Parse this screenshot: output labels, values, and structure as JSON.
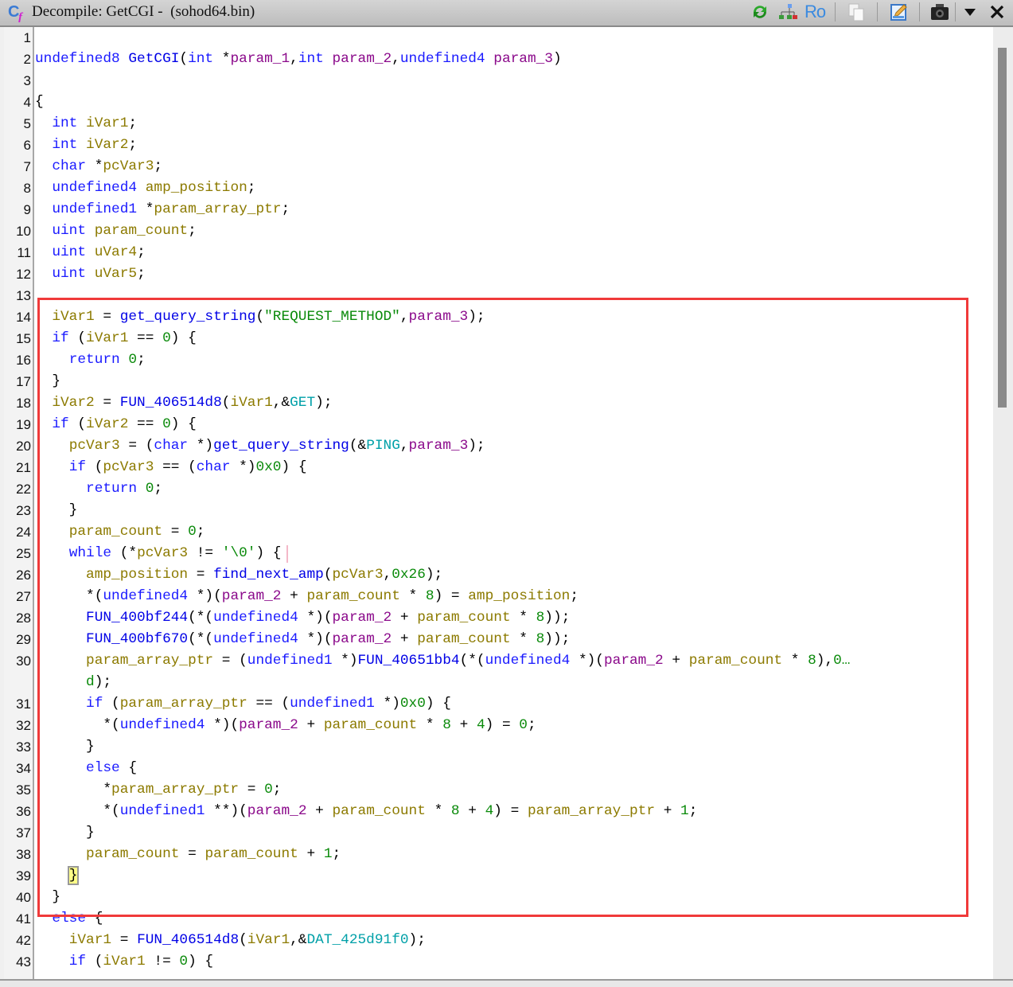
{
  "window": {
    "title": "Decompile: GetCGI -  (sohod64.bin)",
    "icon": "decompiler-cf-icon",
    "toolbar": [
      {
        "name": "refresh-icon"
      },
      {
        "name": "function-graph-icon"
      },
      {
        "name": "ro-toggle-icon",
        "label": "Ro"
      },
      {
        "name": "copy-icon"
      },
      {
        "name": "edit-signature-icon"
      },
      {
        "name": "snapshot-icon"
      },
      {
        "name": "menu-dropdown-icon"
      },
      {
        "name": "close-icon"
      }
    ]
  },
  "colors": {
    "keyword": "#1a1aff",
    "variable": "#8c7a00",
    "param": "#8b0a8b",
    "constant": "#0a8a0a",
    "global": "#00a0a8",
    "highlight_box": "#f03a3a"
  },
  "lines": [
    {
      "n": "1",
      "t": []
    },
    {
      "n": "2",
      "t": [
        [
          "k",
          "undefined8"
        ],
        [
          "o",
          " "
        ],
        [
          "f",
          "GetCGI"
        ],
        [
          "o",
          "("
        ],
        [
          "k",
          "int"
        ],
        [
          "o",
          " *"
        ],
        [
          "p",
          "param_1"
        ],
        [
          "o",
          ","
        ],
        [
          "k",
          "int"
        ],
        [
          "o",
          " "
        ],
        [
          "p",
          "param_2"
        ],
        [
          "o",
          ","
        ],
        [
          "k",
          "undefined4"
        ],
        [
          "o",
          " "
        ],
        [
          "p",
          "param_3"
        ],
        [
          "o",
          ")"
        ]
      ]
    },
    {
      "n": "3",
      "t": []
    },
    {
      "n": "4",
      "t": [
        [
          "o",
          "{"
        ]
      ]
    },
    {
      "n": "5",
      "t": [
        [
          "o",
          "  "
        ],
        [
          "k",
          "int"
        ],
        [
          "o",
          " "
        ],
        [
          "v",
          "iVar1"
        ],
        [
          "o",
          ";"
        ]
      ]
    },
    {
      "n": "6",
      "t": [
        [
          "o",
          "  "
        ],
        [
          "k",
          "int"
        ],
        [
          "o",
          " "
        ],
        [
          "v",
          "iVar2"
        ],
        [
          "o",
          ";"
        ]
      ]
    },
    {
      "n": "7",
      "t": [
        [
          "o",
          "  "
        ],
        [
          "k",
          "char"
        ],
        [
          "o",
          " *"
        ],
        [
          "v",
          "pcVar3"
        ],
        [
          "o",
          ";"
        ]
      ]
    },
    {
      "n": "8",
      "t": [
        [
          "o",
          "  "
        ],
        [
          "k",
          "undefined4"
        ],
        [
          "o",
          " "
        ],
        [
          "v",
          "amp_position"
        ],
        [
          "o",
          ";"
        ]
      ]
    },
    {
      "n": "9",
      "t": [
        [
          "o",
          "  "
        ],
        [
          "k",
          "undefined1"
        ],
        [
          "o",
          " *"
        ],
        [
          "v",
          "param_array_ptr"
        ],
        [
          "o",
          ";"
        ]
      ]
    },
    {
      "n": "10",
      "t": [
        [
          "o",
          "  "
        ],
        [
          "k",
          "uint"
        ],
        [
          "o",
          " "
        ],
        [
          "v",
          "param_count"
        ],
        [
          "o",
          ";"
        ]
      ]
    },
    {
      "n": "11",
      "t": [
        [
          "o",
          "  "
        ],
        [
          "k",
          "uint"
        ],
        [
          "o",
          " "
        ],
        [
          "v",
          "uVar4"
        ],
        [
          "o",
          ";"
        ]
      ]
    },
    {
      "n": "12",
      "t": [
        [
          "o",
          "  "
        ],
        [
          "k",
          "uint"
        ],
        [
          "o",
          " "
        ],
        [
          "v",
          "uVar5"
        ],
        [
          "o",
          ";"
        ]
      ]
    },
    {
      "n": "13",
      "t": []
    },
    {
      "n": "14",
      "t": [
        [
          "o",
          "  "
        ],
        [
          "v",
          "iVar1"
        ],
        [
          "o",
          " = "
        ],
        [
          "f",
          "get_query_string"
        ],
        [
          "o",
          "("
        ],
        [
          "n",
          "\"REQUEST_METHOD\""
        ],
        [
          "o",
          ","
        ],
        [
          "p",
          "param_3"
        ],
        [
          "o",
          ");"
        ]
      ]
    },
    {
      "n": "15",
      "t": [
        [
          "o",
          "  "
        ],
        [
          "k",
          "if"
        ],
        [
          "o",
          " ("
        ],
        [
          "v",
          "iVar1"
        ],
        [
          "o",
          " == "
        ],
        [
          "n",
          "0"
        ],
        [
          "o",
          ") {"
        ]
      ]
    },
    {
      "n": "16",
      "t": [
        [
          "o",
          "    "
        ],
        [
          "k",
          "return"
        ],
        [
          "o",
          " "
        ],
        [
          "n",
          "0"
        ],
        [
          "o",
          ";"
        ]
      ]
    },
    {
      "n": "17",
      "t": [
        [
          "o",
          "  }"
        ]
      ]
    },
    {
      "n": "18",
      "t": [
        [
          "o",
          "  "
        ],
        [
          "v",
          "iVar2"
        ],
        [
          "o",
          " = "
        ],
        [
          "f",
          "FUN_406514d8"
        ],
        [
          "o",
          "("
        ],
        [
          "v",
          "iVar1"
        ],
        [
          "o",
          ",&"
        ],
        [
          "g",
          "GET"
        ],
        [
          "o",
          ");"
        ]
      ]
    },
    {
      "n": "19",
      "t": [
        [
          "o",
          "  "
        ],
        [
          "k",
          "if"
        ],
        [
          "o",
          " ("
        ],
        [
          "v",
          "iVar2"
        ],
        [
          "o",
          " == "
        ],
        [
          "n",
          "0"
        ],
        [
          "o",
          ") {"
        ]
      ]
    },
    {
      "n": "20",
      "t": [
        [
          "o",
          "    "
        ],
        [
          "v",
          "pcVar3"
        ],
        [
          "o",
          " = ("
        ],
        [
          "k",
          "char"
        ],
        [
          "o",
          " *)"
        ],
        [
          "f",
          "get_query_string"
        ],
        [
          "o",
          "(&"
        ],
        [
          "g",
          "PING"
        ],
        [
          "o",
          ","
        ],
        [
          "p",
          "param_3"
        ],
        [
          "o",
          ");"
        ]
      ]
    },
    {
      "n": "21",
      "t": [
        [
          "o",
          "    "
        ],
        [
          "k",
          "if"
        ],
        [
          "o",
          " ("
        ],
        [
          "v",
          "pcVar3"
        ],
        [
          "o",
          " == ("
        ],
        [
          "k",
          "char"
        ],
        [
          "o",
          " *)"
        ],
        [
          "n",
          "0x0"
        ],
        [
          "o",
          ") {"
        ]
      ]
    },
    {
      "n": "22",
      "t": [
        [
          "o",
          "      "
        ],
        [
          "k",
          "return"
        ],
        [
          "o",
          " "
        ],
        [
          "n",
          "0"
        ],
        [
          "o",
          ";"
        ]
      ]
    },
    {
      "n": "23",
      "t": [
        [
          "o",
          "    }"
        ]
      ]
    },
    {
      "n": "24",
      "t": [
        [
          "o",
          "    "
        ],
        [
          "v",
          "param_count"
        ],
        [
          "o",
          " = "
        ],
        [
          "n",
          "0"
        ],
        [
          "o",
          ";"
        ]
      ]
    },
    {
      "n": "25",
      "t": [
        [
          "o",
          "    "
        ],
        [
          "k",
          "while"
        ],
        [
          "o",
          " (*"
        ],
        [
          "v",
          "pcVar3"
        ],
        [
          "o",
          " != "
        ],
        [
          "n",
          "'\\0'"
        ],
        [
          "o",
          ") {"
        ]
      ],
      "caret": true
    },
    {
      "n": "26",
      "t": [
        [
          "o",
          "      "
        ],
        [
          "v",
          "amp_position"
        ],
        [
          "o",
          " = "
        ],
        [
          "f",
          "find_next_amp"
        ],
        [
          "o",
          "("
        ],
        [
          "v",
          "pcVar3"
        ],
        [
          "o",
          ","
        ],
        [
          "n",
          "0x26"
        ],
        [
          "o",
          ");"
        ]
      ]
    },
    {
      "n": "27",
      "t": [
        [
          "o",
          "      *("
        ],
        [
          "k",
          "undefined4"
        ],
        [
          "o",
          " *)("
        ],
        [
          "p",
          "param_2"
        ],
        [
          "o",
          " + "
        ],
        [
          "v",
          "param_count"
        ],
        [
          "o",
          " * "
        ],
        [
          "n",
          "8"
        ],
        [
          "o",
          ") = "
        ],
        [
          "v",
          "amp_position"
        ],
        [
          "o",
          ";"
        ]
      ]
    },
    {
      "n": "28",
      "t": [
        [
          "o",
          "      "
        ],
        [
          "f",
          "FUN_400bf244"
        ],
        [
          "o",
          "(*("
        ],
        [
          "k",
          "undefined4"
        ],
        [
          "o",
          " *)("
        ],
        [
          "p",
          "param_2"
        ],
        [
          "o",
          " + "
        ],
        [
          "v",
          "param_count"
        ],
        [
          "o",
          " * "
        ],
        [
          "n",
          "8"
        ],
        [
          "o",
          "));"
        ]
      ]
    },
    {
      "n": "29",
      "t": [
        [
          "o",
          "      "
        ],
        [
          "f",
          "FUN_400bf670"
        ],
        [
          "o",
          "(*("
        ],
        [
          "k",
          "undefined4"
        ],
        [
          "o",
          " *)("
        ],
        [
          "p",
          "param_2"
        ],
        [
          "o",
          " + "
        ],
        [
          "v",
          "param_count"
        ],
        [
          "o",
          " * "
        ],
        [
          "n",
          "8"
        ],
        [
          "o",
          "));"
        ]
      ]
    },
    {
      "n": "30",
      "t": [
        [
          "o",
          "      "
        ],
        [
          "v",
          "param_array_ptr"
        ],
        [
          "o",
          " = ("
        ],
        [
          "k",
          "undefined1"
        ],
        [
          "o",
          " *)"
        ],
        [
          "f",
          "FUN_40651bb4"
        ],
        [
          "o",
          "(*("
        ],
        [
          "k",
          "undefined4"
        ],
        [
          "o",
          " *)("
        ],
        [
          "p",
          "param_2"
        ],
        [
          "o",
          " + "
        ],
        [
          "v",
          "param_count"
        ],
        [
          "o",
          " * "
        ],
        [
          "n",
          "8"
        ],
        [
          "o",
          "),"
        ],
        [
          "n",
          "0…"
        ]
      ]
    },
    {
      "n": "",
      "t": [
        [
          "o",
          "      "
        ],
        [
          "n",
          "d"
        ],
        [
          "o",
          ");"
        ]
      ]
    },
    {
      "n": "31",
      "t": [
        [
          "o",
          "      "
        ],
        [
          "k",
          "if"
        ],
        [
          "o",
          " ("
        ],
        [
          "v",
          "param_array_ptr"
        ],
        [
          "o",
          " == ("
        ],
        [
          "k",
          "undefined1"
        ],
        [
          "o",
          " *)"
        ],
        [
          "n",
          "0x0"
        ],
        [
          "o",
          ") {"
        ]
      ]
    },
    {
      "n": "32",
      "t": [
        [
          "o",
          "        *("
        ],
        [
          "k",
          "undefined4"
        ],
        [
          "o",
          " *)("
        ],
        [
          "p",
          "param_2"
        ],
        [
          "o",
          " + "
        ],
        [
          "v",
          "param_count"
        ],
        [
          "o",
          " * "
        ],
        [
          "n",
          "8"
        ],
        [
          "o",
          " + "
        ],
        [
          "n",
          "4"
        ],
        [
          "o",
          ") = "
        ],
        [
          "n",
          "0"
        ],
        [
          "o",
          ";"
        ]
      ]
    },
    {
      "n": "33",
      "t": [
        [
          "o",
          "      }"
        ]
      ]
    },
    {
      "n": "34",
      "t": [
        [
          "o",
          "      "
        ],
        [
          "k",
          "else"
        ],
        [
          "o",
          " {"
        ]
      ]
    },
    {
      "n": "35",
      "t": [
        [
          "o",
          "        *"
        ],
        [
          "v",
          "param_array_ptr"
        ],
        [
          "o",
          " = "
        ],
        [
          "n",
          "0"
        ],
        [
          "o",
          ";"
        ]
      ]
    },
    {
      "n": "36",
      "t": [
        [
          "o",
          "        *("
        ],
        [
          "k",
          "undefined1"
        ],
        [
          "o",
          " **)("
        ],
        [
          "p",
          "param_2"
        ],
        [
          "o",
          " + "
        ],
        [
          "v",
          "param_count"
        ],
        [
          "o",
          " * "
        ],
        [
          "n",
          "8"
        ],
        [
          "o",
          " + "
        ],
        [
          "n",
          "4"
        ],
        [
          "o",
          ") = "
        ],
        [
          "v",
          "param_array_ptr"
        ],
        [
          "o",
          " + "
        ],
        [
          "n",
          "1"
        ],
        [
          "o",
          ";"
        ]
      ]
    },
    {
      "n": "37",
      "t": [
        [
          "o",
          "      }"
        ]
      ]
    },
    {
      "n": "38",
      "t": [
        [
          "o",
          "      "
        ],
        [
          "v",
          "param_count"
        ],
        [
          "o",
          " = "
        ],
        [
          "v",
          "param_count"
        ],
        [
          "o",
          " + "
        ],
        [
          "n",
          "1"
        ],
        [
          "o",
          ";"
        ]
      ]
    },
    {
      "n": "39",
      "t": [
        [
          "o",
          "    "
        ],
        [
          "hl",
          "}"
        ]
      ]
    },
    {
      "n": "40",
      "t": [
        [
          "o",
          "  }"
        ]
      ]
    },
    {
      "n": "41",
      "t": [
        [
          "o",
          "  "
        ],
        [
          "k",
          "else"
        ],
        [
          "o",
          " {"
        ]
      ]
    },
    {
      "n": "42",
      "t": [
        [
          "o",
          "    "
        ],
        [
          "v",
          "iVar1"
        ],
        [
          "o",
          " = "
        ],
        [
          "f",
          "FUN_406514d8"
        ],
        [
          "o",
          "("
        ],
        [
          "v",
          "iVar1"
        ],
        [
          "o",
          ",&"
        ],
        [
          "g",
          "DAT_425d91f0"
        ],
        [
          "o",
          ");"
        ]
      ]
    },
    {
      "n": "43",
      "t": [
        [
          "o",
          "    "
        ],
        [
          "k",
          "if"
        ],
        [
          "o",
          " ("
        ],
        [
          "v",
          "iVar1"
        ],
        [
          "o",
          " != "
        ],
        [
          "n",
          "0"
        ],
        [
          "o",
          ") {"
        ]
      ]
    }
  ]
}
